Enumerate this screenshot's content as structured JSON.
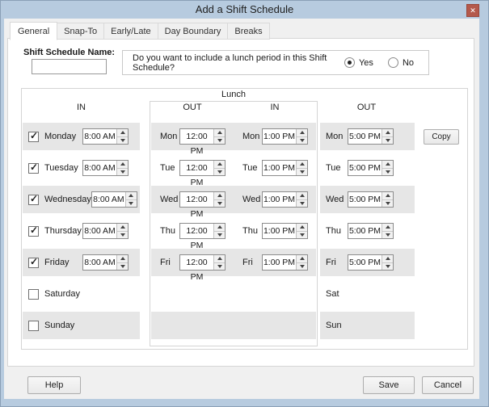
{
  "window": {
    "title": "Add a Shift Schedule",
    "close_glyph": "✕"
  },
  "tabs": [
    {
      "label": "General",
      "active": true
    },
    {
      "label": "Snap-To",
      "active": false
    },
    {
      "label": "Early/Late",
      "active": false
    },
    {
      "label": "Day Boundary",
      "active": false
    },
    {
      "label": "Breaks",
      "active": false
    }
  ],
  "form": {
    "name_label": "Shift Schedule Name:",
    "name_value": "",
    "lunch_question": "Do you want to include a lunch period in this Shift Schedule?",
    "lunch_yes": "Yes",
    "lunch_no": "No",
    "lunch_selected": "Yes"
  },
  "grid": {
    "lunch_header": "Lunch",
    "col_in": "IN",
    "col_lunch_out": "OUT",
    "col_lunch_in": "IN",
    "col_out": "OUT",
    "copy_label": "Copy",
    "rows": [
      {
        "day": "Monday",
        "abbr": "Mon",
        "checked": true,
        "in": "8:00 AM",
        "lunch_out": "12:00 PM",
        "lunch_in": "1:00 PM",
        "out": "5:00 PM"
      },
      {
        "day": "Tuesday",
        "abbr": "Tue",
        "checked": true,
        "in": "8:00 AM",
        "lunch_out": "12:00 PM",
        "lunch_in": "1:00 PM",
        "out": "5:00 PM"
      },
      {
        "day": "Wednesday",
        "abbr": "Wed",
        "checked": true,
        "in": "8:00 AM",
        "lunch_out": "12:00 PM",
        "lunch_in": "1:00 PM",
        "out": "5:00 PM"
      },
      {
        "day": "Thursday",
        "abbr": "Thu",
        "checked": true,
        "in": "8:00 AM",
        "lunch_out": "12:00 PM",
        "lunch_in": "1:00 PM",
        "out": "5:00 PM"
      },
      {
        "day": "Friday",
        "abbr": "Fri",
        "checked": true,
        "in": "8:00 AM",
        "lunch_out": "12:00 PM",
        "lunch_in": "1:00 PM",
        "out": "5:00 PM"
      },
      {
        "day": "Saturday",
        "abbr": "Sat",
        "checked": false,
        "in": "",
        "lunch_out": "",
        "lunch_in": "",
        "out": ""
      },
      {
        "day": "Sunday",
        "abbr": "Sun",
        "checked": false,
        "in": "",
        "lunch_out": "",
        "lunch_in": "",
        "out": ""
      }
    ]
  },
  "footer": {
    "help": "Help",
    "save": "Save",
    "cancel": "Cancel"
  },
  "colors": {
    "titlebar_blue": "#b7cbdf",
    "close_red": "#b4594b",
    "row_gray": "#e6e6e6",
    "content_gray": "#f0f0f0",
    "panel_border": "#d4d4d4"
  }
}
